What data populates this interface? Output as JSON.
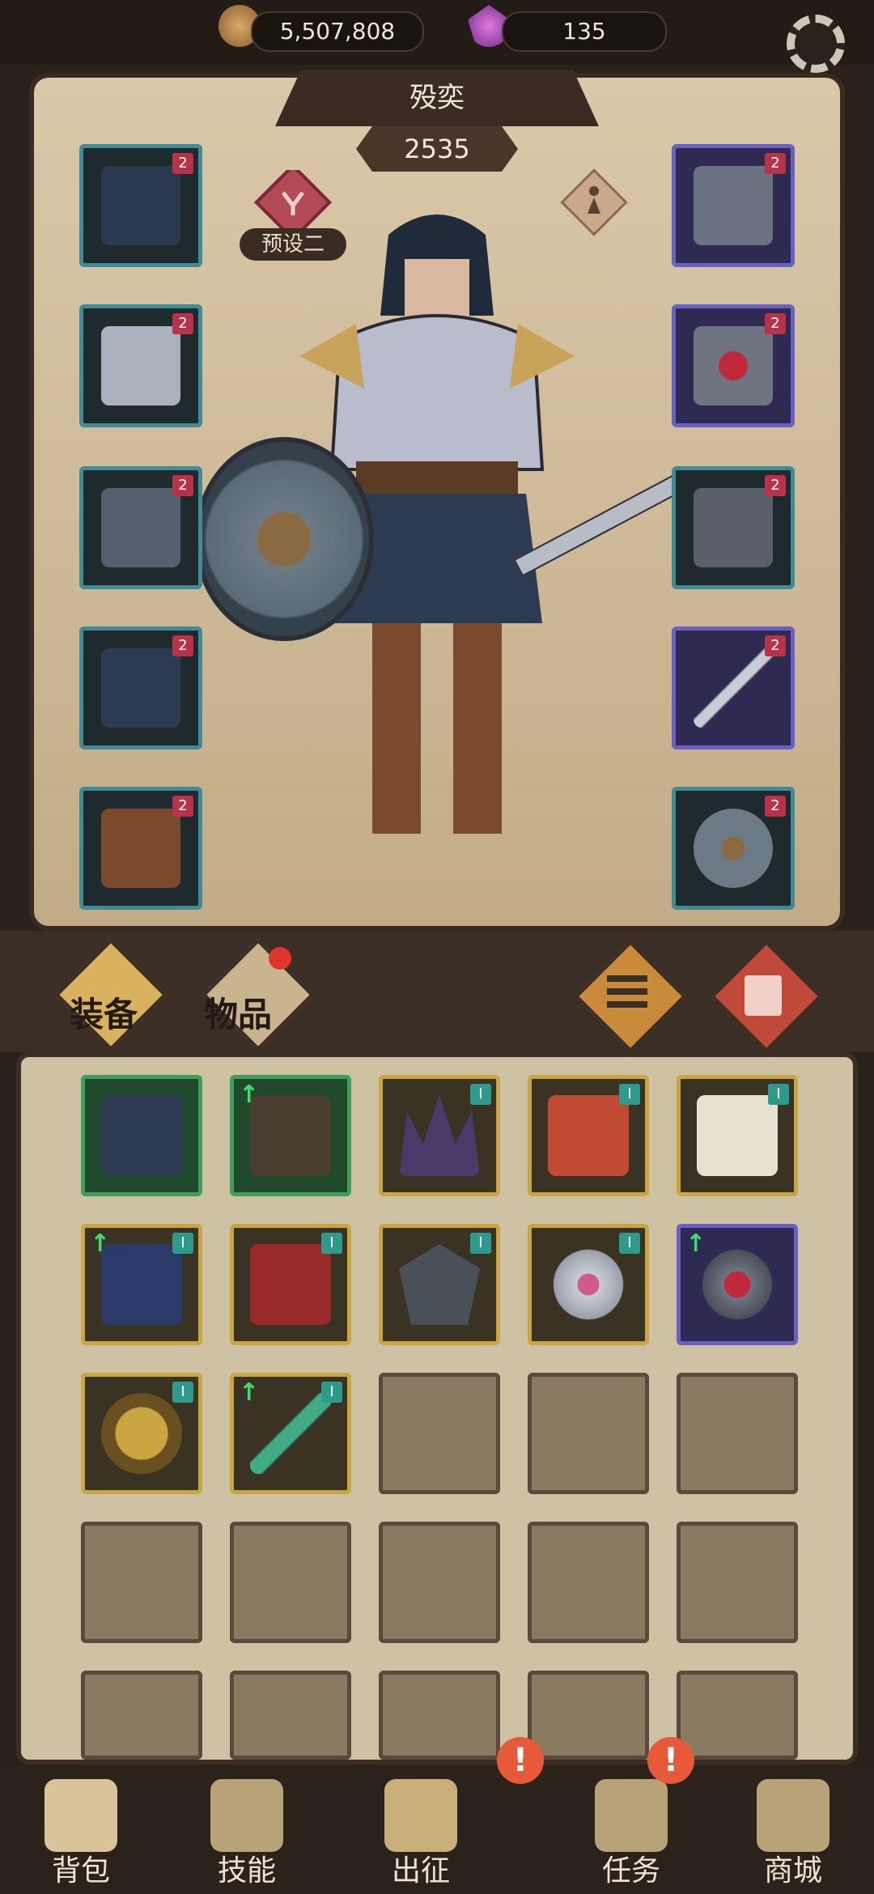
{
  "resources": {
    "coins": "5,507,808",
    "gems": "135"
  },
  "hero": {
    "name": "殁奕",
    "power": "2535",
    "preset_label": "预设二"
  },
  "equipment_slots": {
    "left": [
      {
        "level": "2",
        "item": "hood-icon"
      },
      {
        "level": "2",
        "item": "pauldron-icon"
      },
      {
        "level": "2",
        "item": "gauntlet-icon"
      },
      {
        "level": "2",
        "item": "skirt-armor-icon"
      },
      {
        "level": "2",
        "item": "boots-icon"
      }
    ],
    "right": [
      {
        "level": "2",
        "item": "amulet-icon"
      },
      {
        "level": "2",
        "item": "ring-icon"
      },
      {
        "level": "2",
        "item": "chain-ring-icon"
      },
      {
        "level": "2",
        "item": "sword-icon"
      },
      {
        "level": "2",
        "item": "shield-icon"
      }
    ]
  },
  "tabs": {
    "equipment": "装备",
    "items": "物品"
  },
  "inventory": [
    {
      "frame": "green",
      "upgrade": false,
      "quality": "",
      "item": "bracer-icon"
    },
    {
      "frame": "green",
      "upgrade": true,
      "quality": "",
      "item": "boots-icon"
    },
    {
      "frame": "gold",
      "upgrade": false,
      "quality": "I",
      "item": "crown-icon"
    },
    {
      "frame": "gold",
      "upgrade": false,
      "quality": "I",
      "item": "chest-armor-icon"
    },
    {
      "frame": "gold",
      "upgrade": false,
      "quality": "I",
      "item": "fur-glove-icon"
    },
    {
      "frame": "gold",
      "upgrade": true,
      "quality": "I",
      "item": "pants-icon"
    },
    {
      "frame": "gold",
      "upgrade": false,
      "quality": "I",
      "item": "red-boots-icon"
    },
    {
      "frame": "gold",
      "upgrade": false,
      "quality": "I",
      "item": "shield-plate-icon"
    },
    {
      "frame": "gold",
      "upgrade": false,
      "quality": "I",
      "item": "silver-ring-icon"
    },
    {
      "frame": "purple",
      "upgrade": true,
      "quality": "",
      "item": "ring-icon"
    },
    {
      "frame": "gold",
      "upgrade": false,
      "quality": "I",
      "item": "lion-amulet-icon"
    },
    {
      "frame": "gold",
      "upgrade": true,
      "quality": "I",
      "item": "jade-sword-icon"
    }
  ],
  "nav": [
    {
      "label": "背包",
      "icon": "backpack-icon",
      "alert": false
    },
    {
      "label": "技能",
      "icon": "skill-book-icon",
      "alert": false
    },
    {
      "label": "出征",
      "icon": "expedition-icon",
      "alert": true
    },
    {
      "label": "任务",
      "icon": "quest-icon",
      "alert": true
    },
    {
      "label": "商城",
      "icon": "shop-icon",
      "alert": false
    }
  ],
  "colors": {
    "teal_frame": "#3f8b96",
    "purple_frame": "#6a5fc4",
    "gold_frame": "#c9a640",
    "green_frame": "#3f9e5a",
    "alert": "#e65a3a"
  }
}
